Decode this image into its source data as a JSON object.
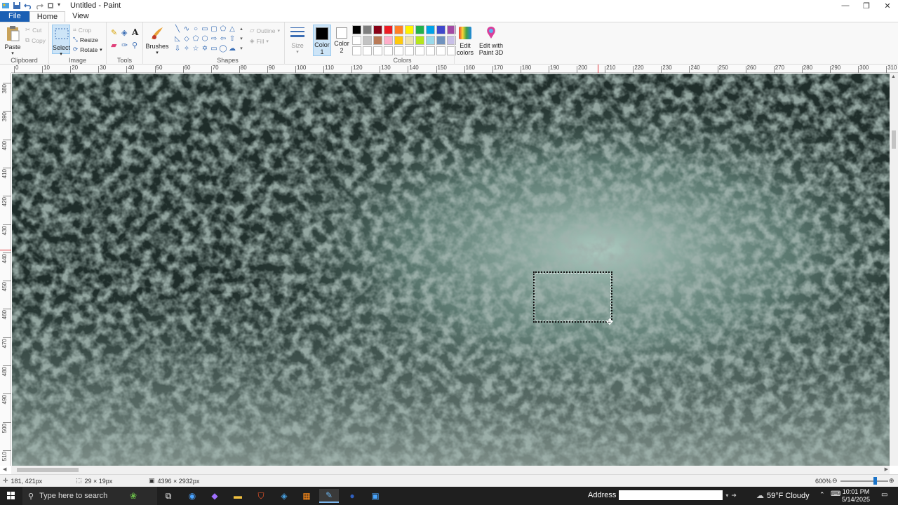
{
  "window": {
    "title": "Untitled - Paint",
    "minimize": "—",
    "maximize": "❐",
    "close": "✕"
  },
  "tabs": [
    "File",
    "Home",
    "View"
  ],
  "ribbon": {
    "clipboard": {
      "label": "Clipboard",
      "paste": "Paste",
      "cut": "Cut",
      "copy": "Copy"
    },
    "image": {
      "label": "Image",
      "select": "Select",
      "crop": "Crop",
      "resize": "Resize",
      "rotate": "Rotate"
    },
    "tools": {
      "label": "Tools"
    },
    "brushes": {
      "label": "Brushes"
    },
    "shapes": {
      "label": "Shapes",
      "outline": "Outline",
      "fill": "Fill"
    },
    "size": {
      "label": "Size"
    },
    "color1": {
      "label1": "Color",
      "label2": "1"
    },
    "color2": {
      "label1": "Color",
      "label2": "2"
    },
    "colors": {
      "label": "Colors"
    },
    "edit_colors": {
      "label1": "Edit",
      "label2": "colors"
    },
    "paint3d": {
      "label1": "Edit with",
      "label2": "Paint 3D"
    },
    "palette_colors": [
      "#000000",
      "#7f7f7f",
      "#880015",
      "#ed1c24",
      "#ff7f27",
      "#fff200",
      "#22b14c",
      "#00a2e8",
      "#3f48cc",
      "#a349a4",
      "#ffffff",
      "#c3c3c3",
      "#b97a57",
      "#ffaec9",
      "#ffc90e",
      "#efe4b0",
      "#b5e61d",
      "#99d9ea",
      "#7092be",
      "#c8bfe7",
      "#ffffff",
      "#ffffff",
      "#ffffff",
      "#ffffff",
      "#ffffff",
      "#ffffff",
      "#ffffff",
      "#ffffff",
      "#ffffff",
      "#ffffff"
    ]
  },
  "ruler": {
    "top": [
      "0",
      "10",
      "20",
      "30",
      "40",
      "50",
      "60",
      "70",
      "80",
      "90",
      "100",
      "110",
      "120",
      "130",
      "140",
      "150",
      "160",
      "170",
      "180",
      "190",
      "200",
      "210",
      "220",
      "230",
      "240",
      "250",
      "260",
      "270",
      "280",
      "290",
      "300",
      "310"
    ],
    "left": [
      "380",
      "390",
      "400",
      "410",
      "420",
      "430",
      "440",
      "450",
      "460",
      "470",
      "480",
      "490",
      "500",
      "510"
    ]
  },
  "status": {
    "cursor_pos": "181, 421px",
    "selection_size": "29 × 19px",
    "image_size": "4396 × 2932px",
    "zoom": "600%"
  },
  "taskbar": {
    "search_placeholder": "Type here to search",
    "address_label": "Address",
    "weather": "59°F  Cloudy",
    "time": "10:01 PM",
    "date": "5/14/2025"
  }
}
